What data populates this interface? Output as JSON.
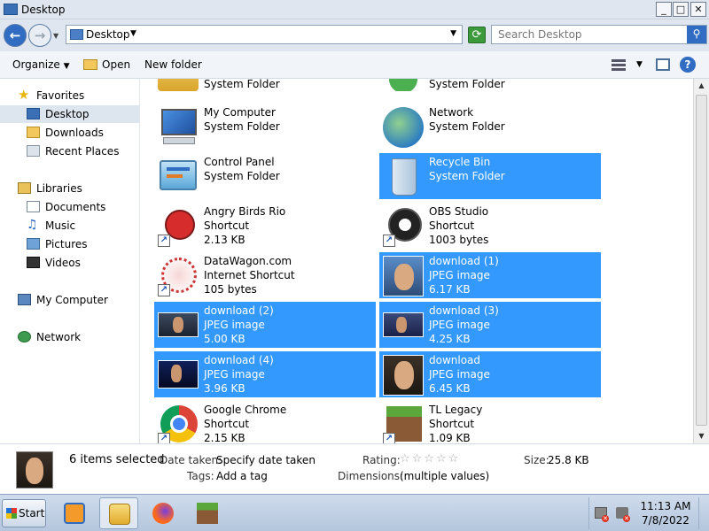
{
  "window": {
    "title": "Desktop",
    "controls": {
      "minimize": "_",
      "maximize": "□",
      "close": "✕"
    }
  },
  "address": {
    "crumb": "Desktop",
    "search_placeholder": "Search Desktop"
  },
  "toolbar": {
    "organize": "Organize",
    "open": "Open",
    "new_folder": "New folder"
  },
  "sidebar": {
    "favorites": "Favorites",
    "fav_items": [
      "Desktop",
      "Downloads",
      "Recent Places"
    ],
    "libraries": "Libraries",
    "lib_items": [
      "Documents",
      "Music",
      "Pictures",
      "Videos"
    ],
    "my_computer": "My Computer",
    "network": "Network"
  },
  "files": [
    {
      "name": "",
      "type": "System Folder",
      "size": "",
      "selected": false,
      "icon": "user-folder-icon"
    },
    {
      "name": "",
      "type": "System Folder",
      "size": "",
      "selected": false,
      "icon": "user-icon"
    },
    {
      "name": "My Computer",
      "type": "System Folder",
      "size": "",
      "selected": false,
      "icon": "computer-icon"
    },
    {
      "name": "Network",
      "type": "System Folder",
      "size": "",
      "selected": false,
      "icon": "network-icon"
    },
    {
      "name": "Control Panel",
      "type": "System Folder",
      "size": "",
      "selected": false,
      "icon": "control-panel-icon"
    },
    {
      "name": "Recycle Bin",
      "type": "System Folder",
      "size": "",
      "selected": true,
      "icon": "recycle-bin-icon"
    },
    {
      "name": "Angry Birds Rio",
      "type": "Shortcut",
      "size": "2.13 KB",
      "selected": false,
      "icon": "angry-birds-icon"
    },
    {
      "name": "OBS Studio",
      "type": "Shortcut",
      "size": "1003 bytes",
      "selected": false,
      "icon": "obs-icon"
    },
    {
      "name": "DataWagon.com",
      "type": "Internet Shortcut",
      "size": "105 bytes",
      "selected": false,
      "icon": "datawagon-icon"
    },
    {
      "name": "download (1)",
      "type": "JPEG image",
      "size": "6.17 KB",
      "selected": true,
      "icon": "photo-thumbnail-icon"
    },
    {
      "name": "download (2)",
      "type": "JPEG image",
      "size": "5.00 KB",
      "selected": true,
      "icon": "photo-thumbnail-icon"
    },
    {
      "name": "download (3)",
      "type": "JPEG image",
      "size": "4.25 KB",
      "selected": true,
      "icon": "photo-thumbnail-icon"
    },
    {
      "name": "download (4)",
      "type": "JPEG image",
      "size": "3.96 KB",
      "selected": true,
      "icon": "photo-thumbnail-icon"
    },
    {
      "name": "download",
      "type": "JPEG image",
      "size": "6.45 KB",
      "selected": true,
      "icon": "photo-thumbnail-icon"
    },
    {
      "name": "Google Chrome",
      "type": "Shortcut",
      "size": "2.15 KB",
      "selected": false,
      "icon": "chrome-icon"
    },
    {
      "name": "TL Legacy",
      "type": "Shortcut",
      "size": "1.09 KB",
      "selected": false,
      "icon": "minecraft-icon"
    }
  ],
  "details": {
    "count": "6 items selected",
    "date_taken_label": "Date taken:",
    "date_taken_value": "Specify date taken",
    "tags_label": "Tags:",
    "tags_value": "Add a tag",
    "rating_label": "Rating:",
    "rating_stars": "☆☆☆☆☆",
    "dimensions_label": "Dimensions:",
    "dimensions_value": "(multiple values)",
    "size_label": "Size:",
    "size_value": "25.8 KB"
  },
  "taskbar": {
    "start": "Start",
    "time": "11:13 AM",
    "date": "7/8/2022"
  },
  "colors": {
    "selection": "#3399ff",
    "accent": "#2f6cc2"
  }
}
